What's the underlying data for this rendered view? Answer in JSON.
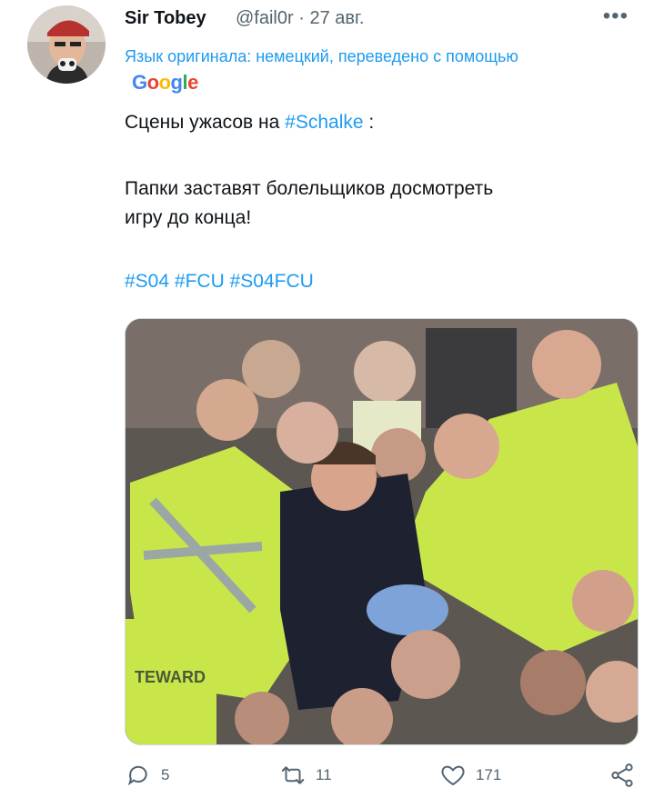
{
  "tweet": {
    "author_name": "Sir Tobey",
    "handle": "@fail0r",
    "separator": "·",
    "date": "27 авг.",
    "more_label": "•••",
    "translated_note": "Язык оригинала: немецкий, переведено с помощью",
    "google_letters": [
      "G",
      "o",
      "o",
      "g",
      "l",
      "e"
    ],
    "line1_text": "Сцены ужасов на ",
    "line1_tag": "#Schalke",
    "line1_suffix": " :",
    "line2": "Папки заставят болельщиков досмотреть",
    "line3": "игру до конца!",
    "hashtags": [
      "#S04",
      "#FCU",
      "#S04FCU"
    ],
    "media_text": "TEWARD"
  },
  "actions": {
    "replies": "5",
    "retweets": "11",
    "likes": "171"
  },
  "colors": {
    "accent": "#1d9bf0",
    "muted": "#536471",
    "text": "#0f1419",
    "hi_vis": "#c8e64a"
  }
}
